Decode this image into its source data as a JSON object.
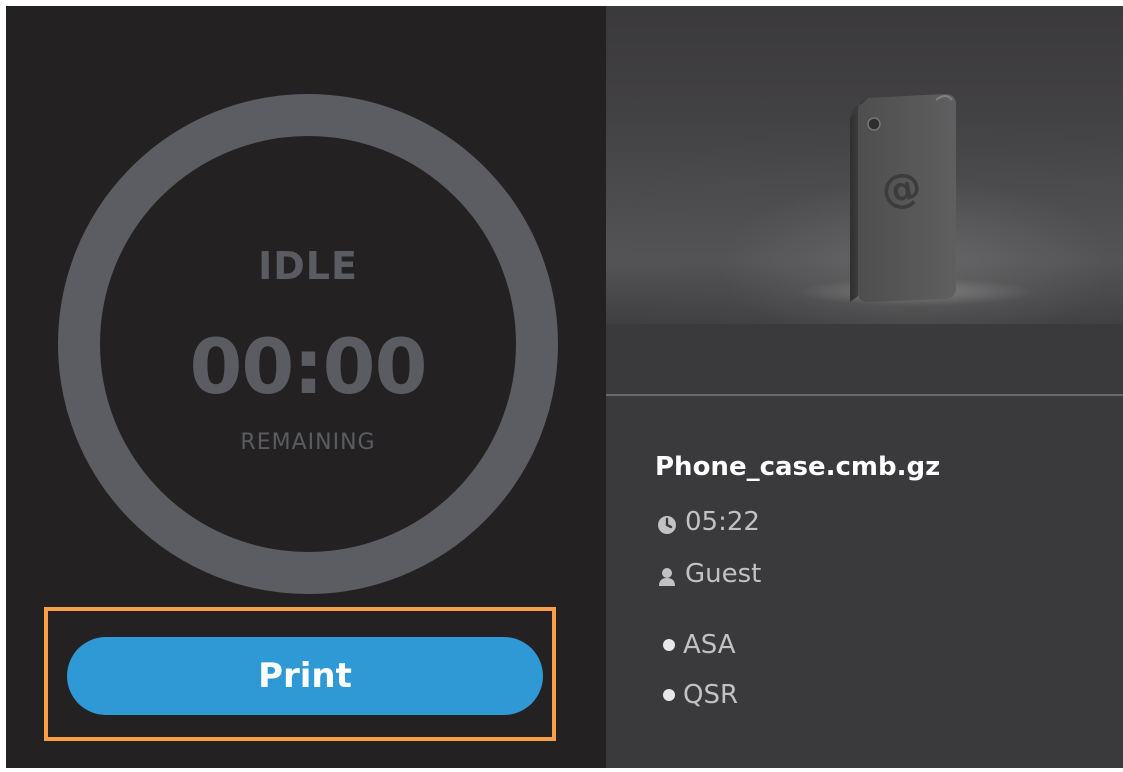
{
  "progress": {
    "status": "IDLE",
    "time": "00:00",
    "time_caption": "REMAINING"
  },
  "actions": {
    "print_label": "Print"
  },
  "job": {
    "file_name": "Phone_case.cmb.gz",
    "duration": "05:22",
    "owner": "Guest",
    "materials": [
      "ASA",
      "QSR"
    ]
  },
  "icons": {
    "duration": "clock-icon",
    "owner": "user-icon",
    "preview": "phone-case-model-preview"
  },
  "colors": {
    "accent": "#2e99d4",
    "highlight": "#f7a047",
    "ring": "#5b5d62"
  }
}
